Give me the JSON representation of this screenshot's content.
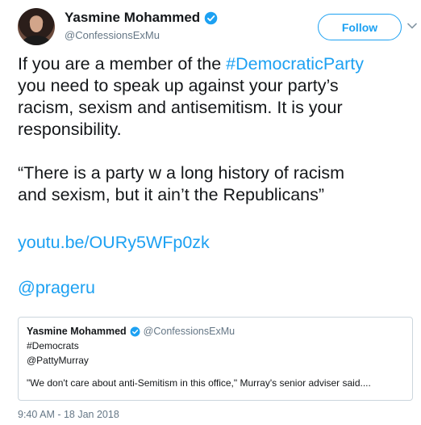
{
  "author": {
    "display_name": "Yasmine Mohammed",
    "handle": "@ConfessionsExMu",
    "verified": true
  },
  "follow_label": "Follow",
  "tweet": {
    "line1_pre": "If you are a member of the ",
    "line1_hashtag": "#DemocraticParty",
    "line2": "you need to speak up against your party’s",
    "line3": "racism, sexism and antisemitism. It is your",
    "line4": "responsibility.",
    "line5": "“There is a party w a long history of racism",
    "line6": "and sexism, but it ain’t the Republicans”",
    "link": "youtu.be/OURy5WFp0zk",
    "mention": "@prageru"
  },
  "quoted_tweet": {
    "display_name": "Yasmine Mohammed",
    "handle": "@ConfessionsExMu",
    "line1": "#Democrats",
    "line2": "@PattyMurray",
    "text": "\"We don't care about anti-Semitism in this office,\" Murray's senior adviser said...."
  },
  "timestamp": "9:40 AM - 18 Jan 2018",
  "colors": {
    "accent": "#1da1f2",
    "secondary_text": "#657786",
    "primary_text": "#14171a",
    "border": "#ccd6dd"
  },
  "icons": {
    "verified": "verified-badge-icon",
    "chevron": "chevron-down-icon"
  }
}
